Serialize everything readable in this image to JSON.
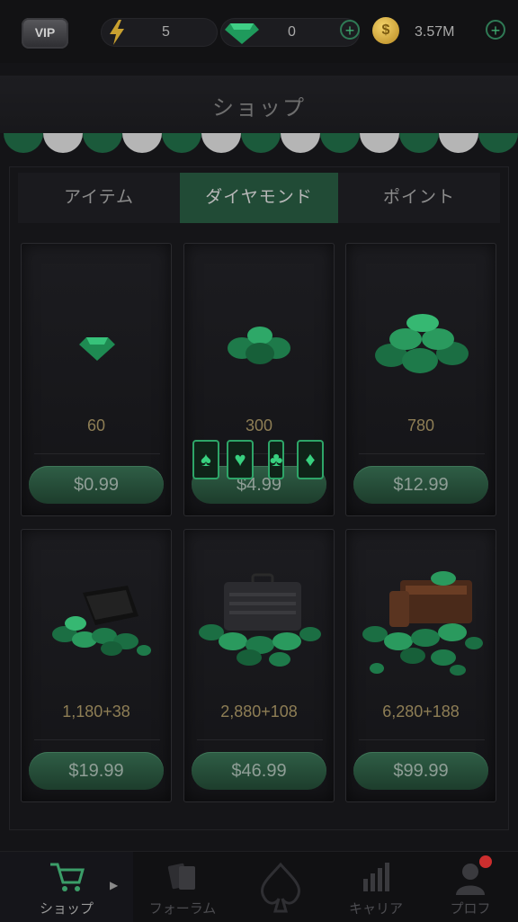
{
  "topbar": {
    "vip_label": "VIP",
    "energy_value": "5",
    "diamond_value": "0",
    "coins_value": "3.57M",
    "colors": {
      "accent": "#2f7a55",
      "coin": "#d9ad3a"
    }
  },
  "title": "ショップ",
  "tabs": [
    {
      "label": "アイテム",
      "active": false
    },
    {
      "label": "ダイヤモンド",
      "active": true
    },
    {
      "label": "ポイント",
      "active": false
    }
  ],
  "products": [
    {
      "amount": "60",
      "price": "$0.99",
      "icon": "single-diamond"
    },
    {
      "amount": "300",
      "price": "$4.99",
      "icon": "diamond-cluster"
    },
    {
      "amount": "780",
      "price": "$12.99",
      "icon": "diamond-pile"
    },
    {
      "amount": "1,180+38",
      "price": "$19.99",
      "icon": "wallet-diamonds"
    },
    {
      "amount": "2,880+108",
      "price": "$46.99",
      "icon": "briefcase-diamonds"
    },
    {
      "amount": "6,280+188",
      "price": "$99.99",
      "icon": "chest-diamonds"
    }
  ],
  "suits": [
    "♠",
    "♥",
    "♣",
    "♦"
  ],
  "nav": [
    {
      "label": "ショップ",
      "icon": "cart-icon",
      "active": true
    },
    {
      "label": "フォーラム",
      "icon": "cards-icon",
      "active": false
    },
    {
      "label": "",
      "icon": "spade-logo-icon",
      "active": false
    },
    {
      "label": "キャリア",
      "icon": "bar-chart-icon",
      "active": false
    },
    {
      "label": "プロフ",
      "icon": "user-icon",
      "active": false
    }
  ]
}
